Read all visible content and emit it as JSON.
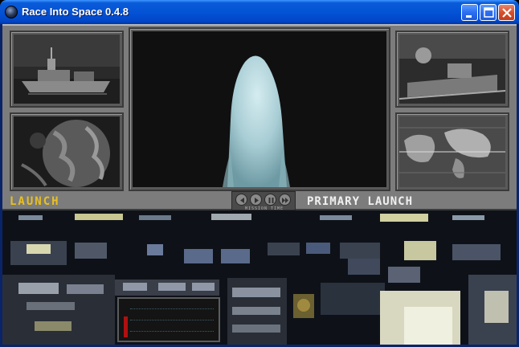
{
  "window": {
    "title": "Race Into Space 0.4.8",
    "controls": {
      "minimize": "minimize-icon",
      "maximize": "maximize-icon",
      "close": "close-icon"
    }
  },
  "console": {
    "status_label": "LAUNCH",
    "mission_label": "PRIMARY LAUNCH",
    "mission_time_label": "MISSION TIME",
    "status_color": "#e8c020",
    "mission_color": "#f0f0f0"
  }
}
